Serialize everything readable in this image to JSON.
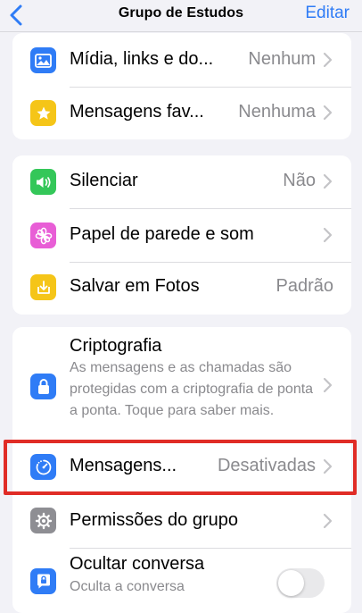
{
  "colors": {
    "accent": "#2f7cf6",
    "highlight_border": "#e02c26",
    "secondary_text": "#8a8a8e"
  },
  "navbar": {
    "title": "Grupo de Estudos",
    "edit_label": "Editar",
    "back_icon": "chevron-left-icon"
  },
  "section1": {
    "media": {
      "label": "Mídia, links e do...",
      "value": "Nenhum",
      "icon": "photo-icon",
      "icon_color": "#2f7cf6"
    },
    "starred": {
      "label": "Mensagens fav...",
      "value": "Nenhuma",
      "icon": "star-icon",
      "icon_color": "#f5c518"
    }
  },
  "section2": {
    "mute": {
      "label": "Silenciar",
      "value": "Não",
      "icon": "speaker-icon",
      "icon_color": "#34c759"
    },
    "wallpaper": {
      "label": "Papel de parede e som",
      "icon": "flower-icon",
      "icon_color": "#e85ed6"
    },
    "save_photos": {
      "label": "Salvar em Fotos",
      "value": "Padrão",
      "icon": "download-icon",
      "icon_color": "#f5c518"
    }
  },
  "section3": {
    "encryption": {
      "label": "Criptografia",
      "description": "As mensagens e as chamadas são protegidas com a criptografia de ponta a ponta. Toque para saber mais.",
      "icon": "lock-icon",
      "icon_color": "#2f7cf6"
    },
    "disappearing": {
      "label": "Mensagens...",
      "value": "Desativadas",
      "icon": "timer-icon",
      "icon_color": "#2f7cf6"
    },
    "permissions": {
      "label": "Permissões do grupo",
      "icon": "gear-icon",
      "icon_color": "#8e8e93"
    },
    "lock_chat": {
      "label": "Ocultar conversa",
      "sublabel": "Oculta a conversa",
      "icon": "lock-chat-icon",
      "icon_color": "#2f7cf6",
      "toggle_on": false
    }
  }
}
